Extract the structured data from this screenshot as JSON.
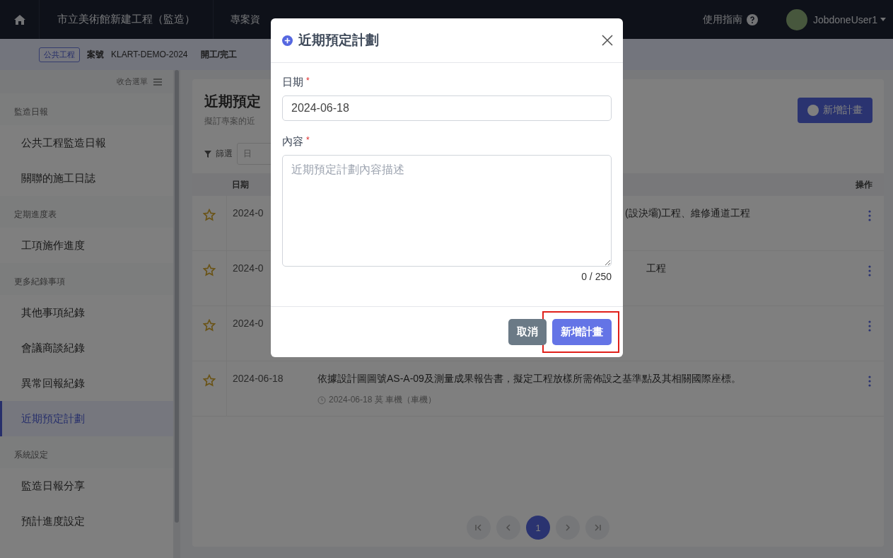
{
  "topbar": {
    "project": "市立美術館新建工程（監造）",
    "nav": [
      "專案資"
    ],
    "help": "使用指南",
    "user": "JobdoneUser1"
  },
  "subbar": {
    "badge": "公共工程",
    "case_label": "案號",
    "case_no": "KLART-DEMO-2024",
    "period": "開工/完工"
  },
  "sidebar": {
    "collapse": "收合選單",
    "sections": [
      {
        "title": "監造日報",
        "items": [
          {
            "label": "公共工程監造日報",
            "selected": false
          },
          {
            "label": "關聯的施工日誌",
            "selected": false
          }
        ]
      },
      {
        "title": "定期進度表",
        "items": [
          {
            "label": "工項施作進度",
            "selected": false
          }
        ]
      },
      {
        "title": "更多紀錄事項",
        "items": [
          {
            "label": "其他事項紀錄",
            "selected": false
          },
          {
            "label": "會議商談紀錄",
            "selected": false
          },
          {
            "label": "異常回報紀錄",
            "selected": false
          },
          {
            "label": "近期預定計劃",
            "selected": true
          }
        ]
      },
      {
        "title": "系統設定",
        "items": [
          {
            "label": "監造日報分享",
            "selected": false
          },
          {
            "label": "預計進度設定",
            "selected": false
          }
        ]
      }
    ]
  },
  "page": {
    "title": "近期預定",
    "subtitle": "擬訂專案的近",
    "add_button": "新增計畫",
    "filter": "篩選",
    "filter_field": "日"
  },
  "table": {
    "columns": [
      "日期",
      "操作"
    ],
    "rows": [
      {
        "starred": true,
        "date": "2024-0",
        "content": "(設決壩)工程、維修通道工程"
      },
      {
        "starred": true,
        "date": "2024-0",
        "content": "工程"
      },
      {
        "starred": true,
        "date": "2024-0"
      },
      {
        "starred": true,
        "date": "2024-06-18",
        "content": "依據設計圖圖號AS-A-09及測量成果報告書，擬定工程放樣所需佈設之基準點及其相關國際座標。",
        "meta": "2024-06-18 莫 車機（車機）"
      }
    ]
  },
  "pagination": {
    "pages": [
      {
        "label": "1",
        "selected": true
      }
    ]
  },
  "dialog": {
    "title": "近期預定計劃",
    "fields": [
      {
        "kind": "input",
        "label": "日期",
        "required_mark": "*",
        "value": "2024-06-18"
      },
      {
        "kind": "textarea",
        "label": "內容",
        "required_mark": "*",
        "placeholder": "近期預定計劃內容描述",
        "counter": "0 / 250"
      }
    ],
    "buttons": [
      {
        "kind": "secondary",
        "label": "取消",
        "highlighted": false
      },
      {
        "kind": "primary",
        "label": "新增計畫",
        "highlighted": true
      }
    ]
  }
}
